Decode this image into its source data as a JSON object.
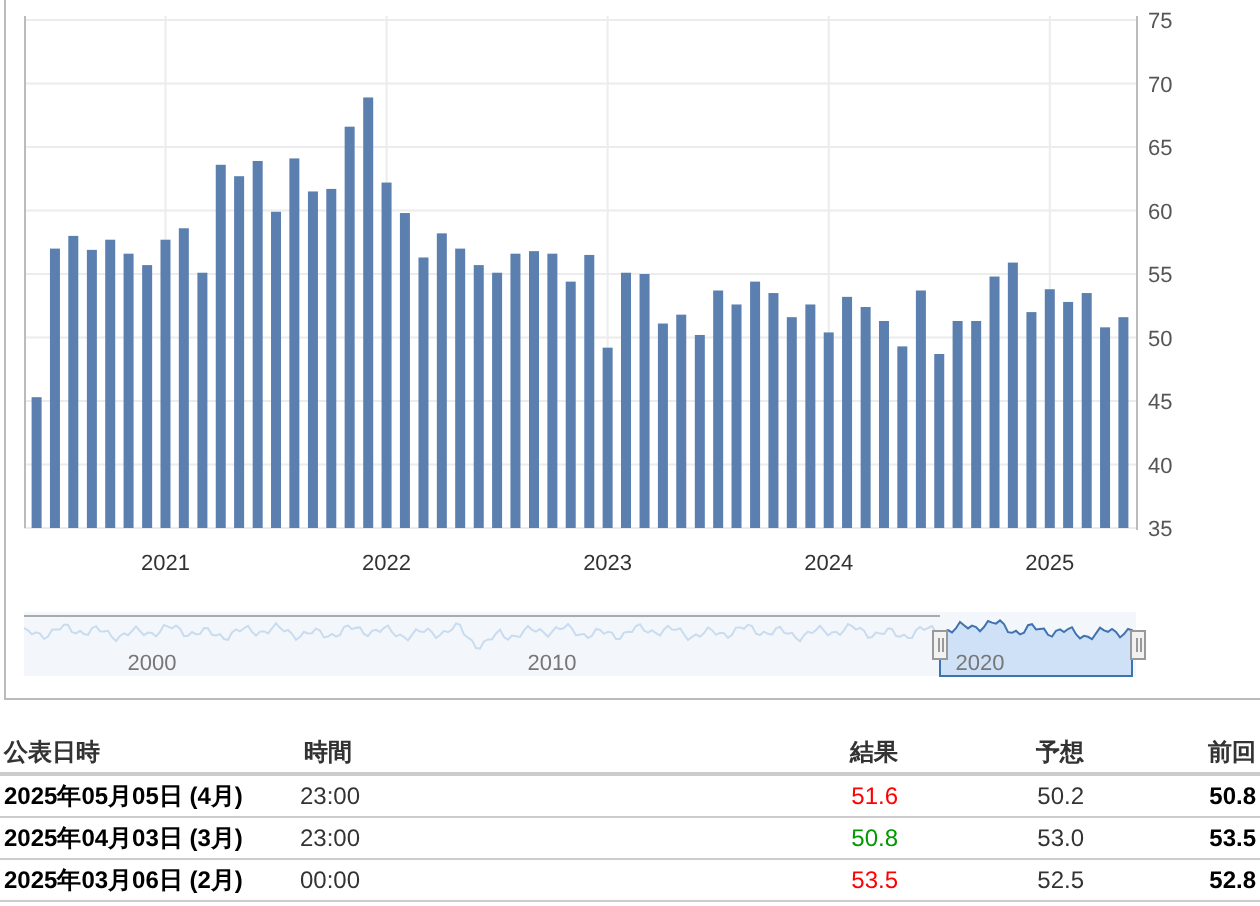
{
  "chart": {
    "chart_data": {
      "type": "bar",
      "grid": true,
      "x": [
        2020.417,
        2020.5,
        2020.583,
        2020.667,
        2020.75,
        2020.833,
        2020.917,
        2021.0,
        2021.083,
        2021.167,
        2021.25,
        2021.333,
        2021.417,
        2021.5,
        2021.583,
        2021.667,
        2021.75,
        2021.833,
        2021.917,
        2022.0,
        2022.083,
        2022.167,
        2022.25,
        2022.333,
        2022.417,
        2022.5,
        2022.583,
        2022.667,
        2022.75,
        2022.833,
        2022.917,
        2023.0,
        2023.083,
        2023.167,
        2023.25,
        2023.333,
        2023.417,
        2023.5,
        2023.583,
        2023.667,
        2023.75,
        2023.833,
        2023.917,
        2024.0,
        2024.083,
        2024.167,
        2024.25,
        2024.333,
        2024.417,
        2024.5,
        2024.583,
        2024.667,
        2024.75,
        2024.833,
        2024.917,
        2025.0,
        2025.083,
        2025.167,
        2025.25,
        2025.333
      ],
      "series": [
        {
          "color": "#5b7fae",
          "values": [
            45.3,
            57.0,
            58.0,
            56.9,
            57.7,
            56.6,
            55.7,
            57.7,
            58.6,
            55.1,
            63.6,
            62.7,
            63.9,
            59.9,
            64.1,
            61.5,
            61.7,
            66.6,
            68.9,
            62.2,
            59.8,
            56.3,
            58.2,
            57.0,
            55.7,
            55.1,
            56.6,
            56.8,
            56.6,
            54.4,
            56.5,
            49.2,
            55.1,
            55.0,
            51.1,
            51.8,
            50.2,
            53.7,
            52.6,
            54.4,
            53.5,
            51.6,
            52.6,
            50.4,
            53.2,
            52.4,
            51.3,
            49.3,
            53.7,
            48.7,
            51.3,
            51.3,
            54.8,
            55.9,
            52.0,
            53.8,
            52.8,
            53.5,
            50.8,
            51.6
          ]
        }
      ],
      "xlim": [
        2020.36,
        2025.39
      ],
      "ylim": [
        35,
        75
      ],
      "yticks": [
        35,
        40,
        45,
        50,
        55,
        60,
        65,
        70,
        75
      ],
      "xticks": [
        2021,
        2022,
        2023,
        2024,
        2025
      ]
    }
  },
  "navigator": {
    "labels": [
      "2000",
      "2010",
      "2020"
    ]
  },
  "table": {
    "columns": [
      "公表日時",
      "時間",
      "結果",
      "予想",
      "前回"
    ],
    "rows": [
      {
        "date": "2025年05月05日 (4月)",
        "time": "23:00",
        "actual": "51.6",
        "color": "#ff0000",
        "forecast": "50.2",
        "previous": "50.8"
      },
      {
        "date": "2025年04月03日 (3月)",
        "time": "23:00",
        "actual": "50.8",
        "color": "#009900",
        "forecast": "53.0",
        "previous": "53.5"
      },
      {
        "date": "2025年03月06日 (2月)",
        "time": "00:00",
        "actual": "53.5",
        "color": "#ff0000",
        "forecast": "52.5",
        "previous": "52.8"
      }
    ]
  }
}
